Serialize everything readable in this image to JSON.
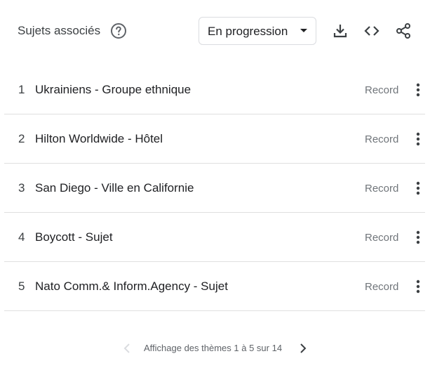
{
  "header": {
    "title": "Sujets associés",
    "help_icon": "help-circle-icon",
    "dropdown": {
      "selected": "En progression"
    },
    "tools": [
      "download-icon",
      "embed-code-icon",
      "share-icon"
    ]
  },
  "items": [
    {
      "rank": "1",
      "label": "Ukrainiens - Groupe ethnique",
      "value": "Record"
    },
    {
      "rank": "2",
      "label": "Hilton Worldwide - Hôtel",
      "value": "Record"
    },
    {
      "rank": "3",
      "label": "San Diego - Ville en Californie",
      "value": "Record"
    },
    {
      "rank": "4",
      "label": "Boycott - Sujet",
      "value": "Record"
    },
    {
      "rank": "5",
      "label": "Nato Comm.& Inform.Agency - Sujet",
      "value": "Record"
    }
  ],
  "pagination": {
    "text": "Affichage des thèmes 1 à 5 sur 14"
  },
  "colors": {
    "text_primary": "#202124",
    "text_secondary": "#70757a",
    "divider": "#e0e0e0",
    "icon": "#5f6368"
  }
}
